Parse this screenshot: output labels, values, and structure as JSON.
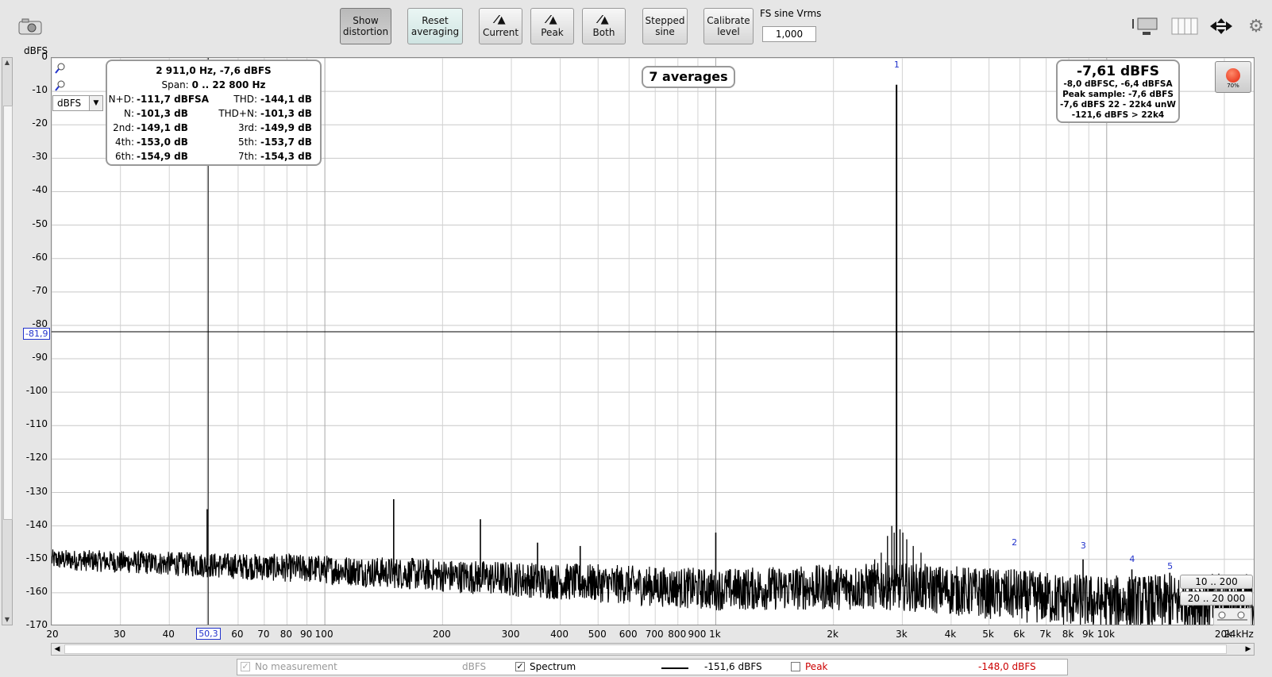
{
  "toolbar": {
    "show_distortion": "Show\ndistortion",
    "reset_averaging": "Reset\naveraging",
    "current": "Current",
    "peak": "Peak",
    "both": "Both",
    "stepped_sine": "Stepped\nsine",
    "calibrate_level": "Calibrate\nlevel",
    "fs_sine_label": "FS sine Vrms",
    "fs_sine_value": "1,000"
  },
  "plot": {
    "y_unit": "dBFS",
    "units_select": "dBFS",
    "cursor_y": "-81,9",
    "cursor_x": "50,3",
    "averages": "7 averages",
    "y_ticks": [
      "0",
      "-10",
      "-20",
      "-30",
      "-40",
      "-50",
      "-60",
      "-70",
      "-80",
      "-90",
      "-100",
      "-110",
      "-120",
      "-130",
      "-140",
      "-150",
      "-160",
      "-170"
    ],
    "x_ticks": [
      "20",
      "30",
      "40",
      "60",
      "70",
      "80",
      "90",
      "100",
      "200",
      "300",
      "400",
      "500",
      "600",
      "700",
      "800",
      "900",
      "1k",
      "2k",
      "3k",
      "4k",
      "5k",
      "6k",
      "7k",
      "8k",
      "9k",
      "10k",
      "20k",
      "24kHz"
    ],
    "harmonic_markers": [
      "1",
      "2",
      "3",
      "4",
      "5"
    ],
    "range_buttons": [
      "10 .. 200",
      "20 .. 20 000"
    ]
  },
  "info": {
    "header1": "2 911,0 Hz, -7,6 dBFS",
    "span_label": "Span:",
    "span_value": "0 .. 22 800 Hz",
    "rows": [
      {
        "l1": "N+D:",
        "v1": "-111,7 dBFSA",
        "l2": "THD:",
        "v2": "-144,1 dB"
      },
      {
        "l1": "N:",
        "v1": "-101,3 dB",
        "l2": "THD+N:",
        "v2": "-101,3 dB"
      },
      {
        "l1": "2nd:",
        "v1": "-149,1 dB",
        "l2": "3rd:",
        "v2": "-149,9 dB"
      },
      {
        "l1": "4th:",
        "v1": "-153,0 dB",
        "l2": "5th:",
        "v2": "-153,7 dB"
      },
      {
        "l1": "6th:",
        "v1": "-154,9 dB",
        "l2": "7th:",
        "v2": "-154,3 dB"
      }
    ]
  },
  "level": {
    "main": "-7,61 dBFS",
    "line1": "-8,0 dBFSC, -6,4 dBFSA",
    "line2": "Peak sample: -7,6 dBFS",
    "line3": "-7,6 dBFS 22 - 22k4 unW",
    "line4": "-121,6 dBFS > 22k4",
    "rec_pct": "70%"
  },
  "legend": {
    "no_measurement": "No measurement",
    "no_measurement_unit": "dBFS",
    "spectrum": "Spectrum",
    "spectrum_value": "-151,6 dBFS",
    "peak": "Peak",
    "peak_value": "-148,0 dBFS"
  },
  "colors": {
    "accent_blue": "#2233cc",
    "peak_red": "#cc0000",
    "record_red": "#e2230c"
  },
  "chart_data": {
    "type": "line",
    "xlabel": "",
    "ylabel": "dBFS",
    "x_scale": "log",
    "xlim": [
      20,
      24000
    ],
    "ylim": [
      -170,
      0
    ],
    "noise_floor_db": [
      [
        20,
        -150
      ],
      [
        100,
        -153
      ],
      [
        1000,
        -159
      ],
      [
        2900,
        -158
      ],
      [
        10000,
        -163
      ],
      [
        24000,
        -163
      ]
    ],
    "peaks": [
      {
        "x": 50,
        "y": -135
      },
      {
        "x": 150,
        "y": -132
      },
      {
        "x": 250,
        "y": -138
      },
      {
        "x": 350,
        "y": -145
      },
      {
        "x": 450,
        "y": -146
      },
      {
        "x": 1000,
        "y": -142
      },
      {
        "x": 2900,
        "y": -8
      },
      {
        "x": 5800,
        "y": -153
      },
      {
        "x": 8700,
        "y": -150
      },
      {
        "x": 11600,
        "y": -153
      },
      {
        "x": 14500,
        "y": -154
      }
    ]
  }
}
